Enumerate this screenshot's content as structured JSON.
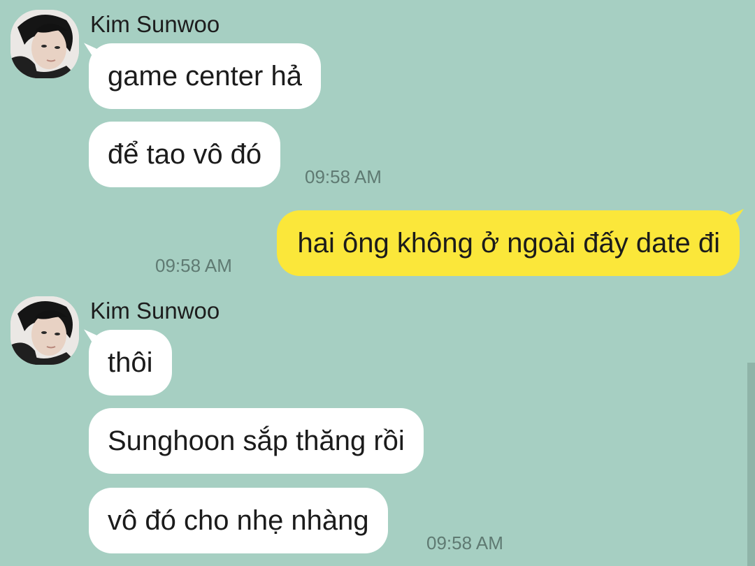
{
  "messages": [
    {
      "sender": "Kim Sunwoo",
      "bubbles": [
        "game center hả",
        "để tao vô đó"
      ],
      "time": "09:58 AM"
    },
    {
      "outgoing": "hai ông không ở ngoài đấy date đi",
      "time": "09:58 AM"
    },
    {
      "sender": "Kim Sunwoo",
      "bubbles": [
        "thôi",
        "Sunghoon sắp thăng rồi",
        "vô đó cho nhẹ nhàng"
      ],
      "time": "09:58 AM"
    }
  ],
  "colors": {
    "background": "#a6cfc2",
    "incoming_bubble": "#ffffff",
    "outgoing_bubble": "#fbe73a",
    "timestamp": "#5f7a72"
  },
  "icons": {
    "avatar": "profile-photo"
  }
}
